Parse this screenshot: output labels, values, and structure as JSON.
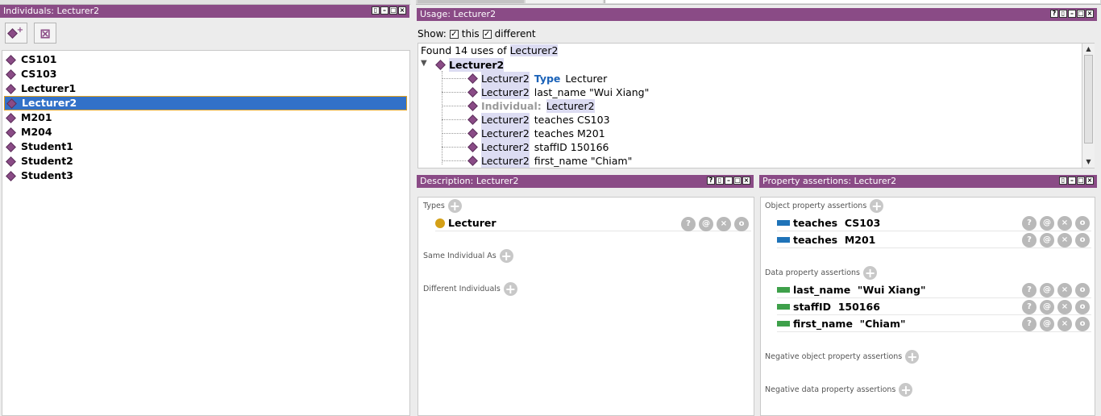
{
  "individuals_panel": {
    "title": "Individuals: Lecturer2",
    "items": [
      {
        "label": "CS101"
      },
      {
        "label": "CS103"
      },
      {
        "label": "Lecturer1"
      },
      {
        "label": "Lecturer2"
      },
      {
        "label": "M201"
      },
      {
        "label": "M204"
      },
      {
        "label": "Student1"
      },
      {
        "label": "Student2"
      },
      {
        "label": "Student3"
      }
    ],
    "selected": "Lecturer2"
  },
  "usage_panel": {
    "title": "Usage: Lecturer2",
    "show_label": "Show:",
    "this_label": "this",
    "different_label": "different",
    "found_prefix": "Found 14 uses of",
    "found_entity": "Lecturer2",
    "root": "Lecturer2",
    "rows": [
      {
        "subject": "Lecturer2",
        "keyword": "Type",
        "rest": "Lecturer"
      },
      {
        "subject": "Lecturer2",
        "keyword": "",
        "rest": "last_name \"Wui Xiang\""
      },
      {
        "subject": "Individual:",
        "keyword": "",
        "rest": "Lecturer2"
      },
      {
        "subject": "Lecturer2",
        "keyword": "",
        "rest": "teaches CS103"
      },
      {
        "subject": "Lecturer2",
        "keyword": "",
        "rest": "teaches M201"
      },
      {
        "subject": "Lecturer2",
        "keyword": "",
        "rest": "staffID 150166"
      },
      {
        "subject": "Lecturer2",
        "keyword": "",
        "rest": "first_name \"Chiam\""
      }
    ]
  },
  "description_panel": {
    "title": "Description: Lecturer2",
    "types_label": "Types",
    "type_value": "Lecturer",
    "same_label": "Same Individual As",
    "different_label": "Different Individuals"
  },
  "property_panel": {
    "title": "Property assertions: Lecturer2",
    "object_label": "Object property assertions",
    "object_rows": [
      {
        "text": "teaches  CS103"
      },
      {
        "text": "teaches  M201"
      }
    ],
    "data_label": "Data property assertions",
    "data_rows": [
      {
        "text": "last_name  \"Wui Xiang\""
      },
      {
        "text": "staffID  150166"
      },
      {
        "text": "first_name  \"Chiam\""
      }
    ],
    "neg_object_label": "Negative object property assertions",
    "neg_data_label": "Negative data property assertions"
  },
  "icons": {
    "plus": "+",
    "help": "?",
    "annotate": "@",
    "delete": "×",
    "edit": "o"
  },
  "colors": {
    "titlebar": "#8a4b86",
    "selection": "#3271c8",
    "object_property": "#1f73b8",
    "data_property": "#3ea04a",
    "type_class": "#d4a017"
  }
}
